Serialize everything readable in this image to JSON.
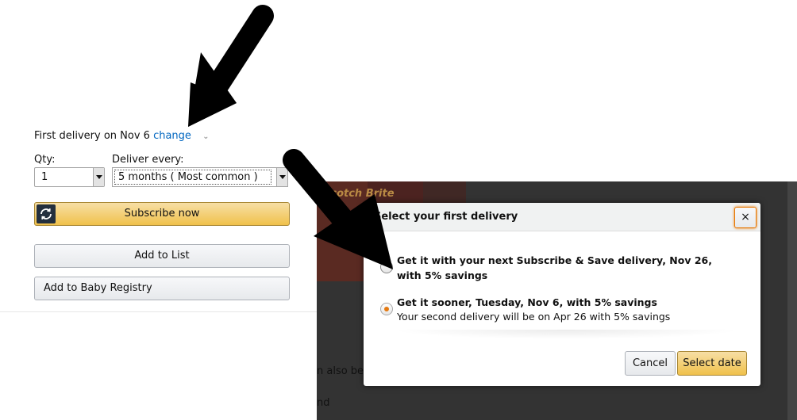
{
  "product": {
    "first_delivery_text": "First delivery on Nov 6",
    "change_link": "change",
    "qty_label": "Qty:",
    "qty_value": "1",
    "deliver_label": "Deliver every:",
    "deliver_value": "5 months ( Most common )",
    "subscribe_label": "Subscribe now",
    "add_to_list_label": "Add to List",
    "add_to_registry_label": "Add to Baby Registry"
  },
  "background": {
    "thumb_logo": "Scotch Brite",
    "partial_text_1": "n also be",
    "partial_text_2": "nd"
  },
  "modal": {
    "title": "Select your first delivery",
    "close_glyph": "×",
    "options": [
      {
        "title": "Get it with your next Subscribe & Save delivery, Nov 26, with 5% savings",
        "subtitle": "",
        "selected": false
      },
      {
        "title": "Get it sooner, Tuesday, Nov 6, with 5% savings",
        "subtitle": "Your second delivery will be on Apr 26 with 5% savings",
        "selected": true
      }
    ],
    "cancel_label": "Cancel",
    "select_label": "Select date"
  },
  "colors": {
    "link": "#0066c0",
    "primary_button": "#f0c14b",
    "selected_radio": "#e47911",
    "overlay": "#333333"
  }
}
